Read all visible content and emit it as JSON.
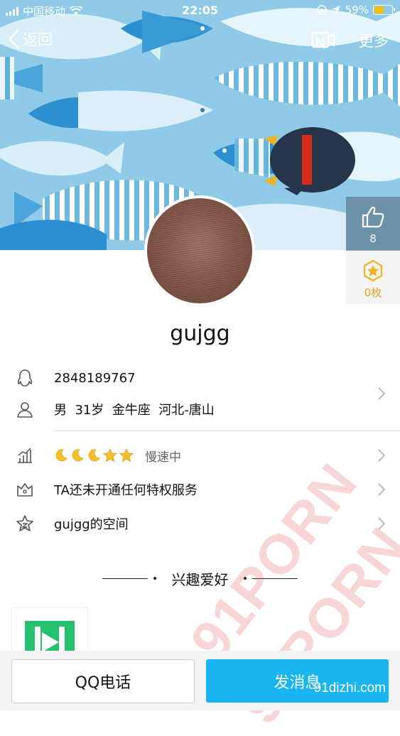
{
  "status_bar": {
    "carrier": "中国移动",
    "time": "22:05",
    "battery": "59%",
    "battery_level": 0.59
  },
  "nav": {
    "back_label": "返回",
    "more_label": "更多"
  },
  "side": {
    "likes": "8",
    "coins": "0枚"
  },
  "profile": {
    "nickname": "gujgg",
    "qq_number": "2848189767",
    "basic_info": "男  31岁  金牛座  河北-唐山",
    "level_status": "慢速中",
    "level_icons": [
      "moon",
      "moon",
      "moon",
      "star",
      "star"
    ],
    "privilege": "TA还未开通任何特权服务",
    "space": "gujgg的空间"
  },
  "hobbies": {
    "title": "兴趣爱好"
  },
  "actions": {
    "call_label": "QQ电话",
    "message_label": "发消息"
  },
  "watermark": {
    "text1": "91PORN",
    "text2": "91PORN",
    "site": "91dizhi.com"
  },
  "colors": {
    "accent": "#19b4f2",
    "banner_bg": "#8fcbe8",
    "coin": "#e8a020"
  }
}
